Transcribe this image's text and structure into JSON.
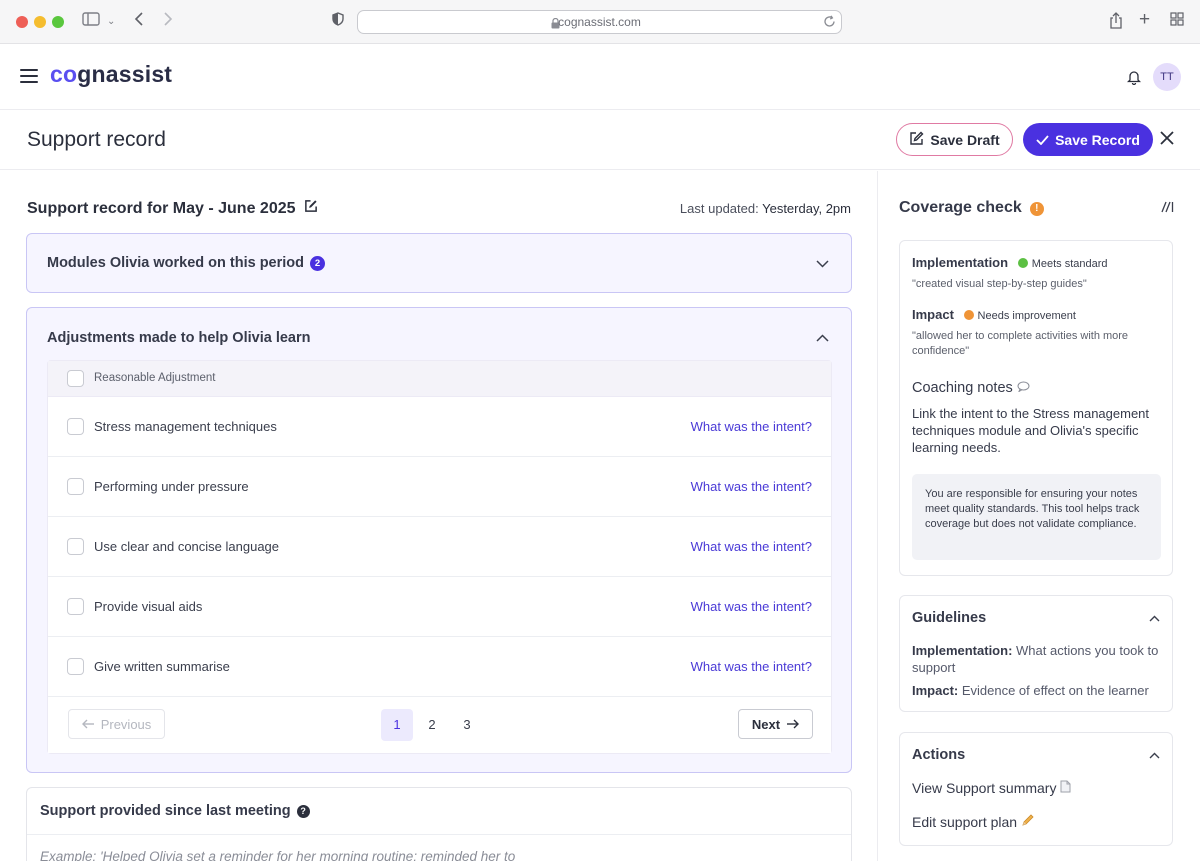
{
  "browser": {
    "url": "cognassist.com",
    "traffic_colors": [
      "#ee5f57",
      "#f5bd2f",
      "#5ac73e"
    ]
  },
  "app": {
    "logo_prefix": "co",
    "logo_rest": "gnassist",
    "avatar_initials": "TT",
    "accent": "#4a31e0"
  },
  "page": {
    "title": "Support record",
    "save_draft_label": "Save Draft",
    "save_record_label": "Save Record"
  },
  "record": {
    "heading": "Support record for May - June 2025",
    "last_updated_label": "Last updated:",
    "last_updated_value": "Yesterday, 2pm"
  },
  "modules": {
    "title": "Modules Olivia worked on this period",
    "count": "2"
  },
  "adjustments": {
    "title": "Adjustments made to help Olivia learn",
    "column_header": "Reasonable Adjustment",
    "rows": [
      {
        "label": "Stress management techniques",
        "action": "What was the intent?"
      },
      {
        "label": "Performing under pressure",
        "action": "What was the intent?"
      },
      {
        "label": "Use clear and concise language",
        "action": "What was the intent?"
      },
      {
        "label": "Provide visual aids",
        "action": "What was the intent?"
      },
      {
        "label": "Give written summarise",
        "action": "What was the intent?"
      }
    ],
    "pagination": {
      "previous_label": "Previous",
      "next_label": "Next",
      "pages": [
        "1",
        "2",
        "3"
      ],
      "current": "1"
    }
  },
  "support": {
    "title": "Support provided since last meeting",
    "placeholder": "Example: 'Helped Olivia set a reminder for her morning routine; reminded her to"
  },
  "coverage": {
    "title": "Coverage check",
    "implementation": {
      "label": "Implementation",
      "status": "Meets standard",
      "status_color": "#5cc043",
      "quote": "\"created visual step-by-step guides\""
    },
    "impact": {
      "label": "Impact",
      "status": "Needs improvement",
      "status_color": "#ef9437",
      "quote": "\"allowed her to complete activities with more confidence\""
    },
    "coaching_title": "Coaching notes",
    "coaching_text": "Link the intent to the Stress management techniques module and Olivia's specific learning needs.",
    "notice": "You are responsible for ensuring your notes meet quality standards. This tool helps track coverage but does not validate compliance."
  },
  "guidelines": {
    "title": "Guidelines",
    "impl_label": "Implementation:",
    "impl_text": " What actions you took to support",
    "impact_label": "Impact:",
    "impact_text": " Evidence of effect on the learner"
  },
  "actions": {
    "title": "Actions",
    "items": [
      {
        "label": "View Support summary"
      },
      {
        "label": "Edit support plan"
      }
    ]
  }
}
